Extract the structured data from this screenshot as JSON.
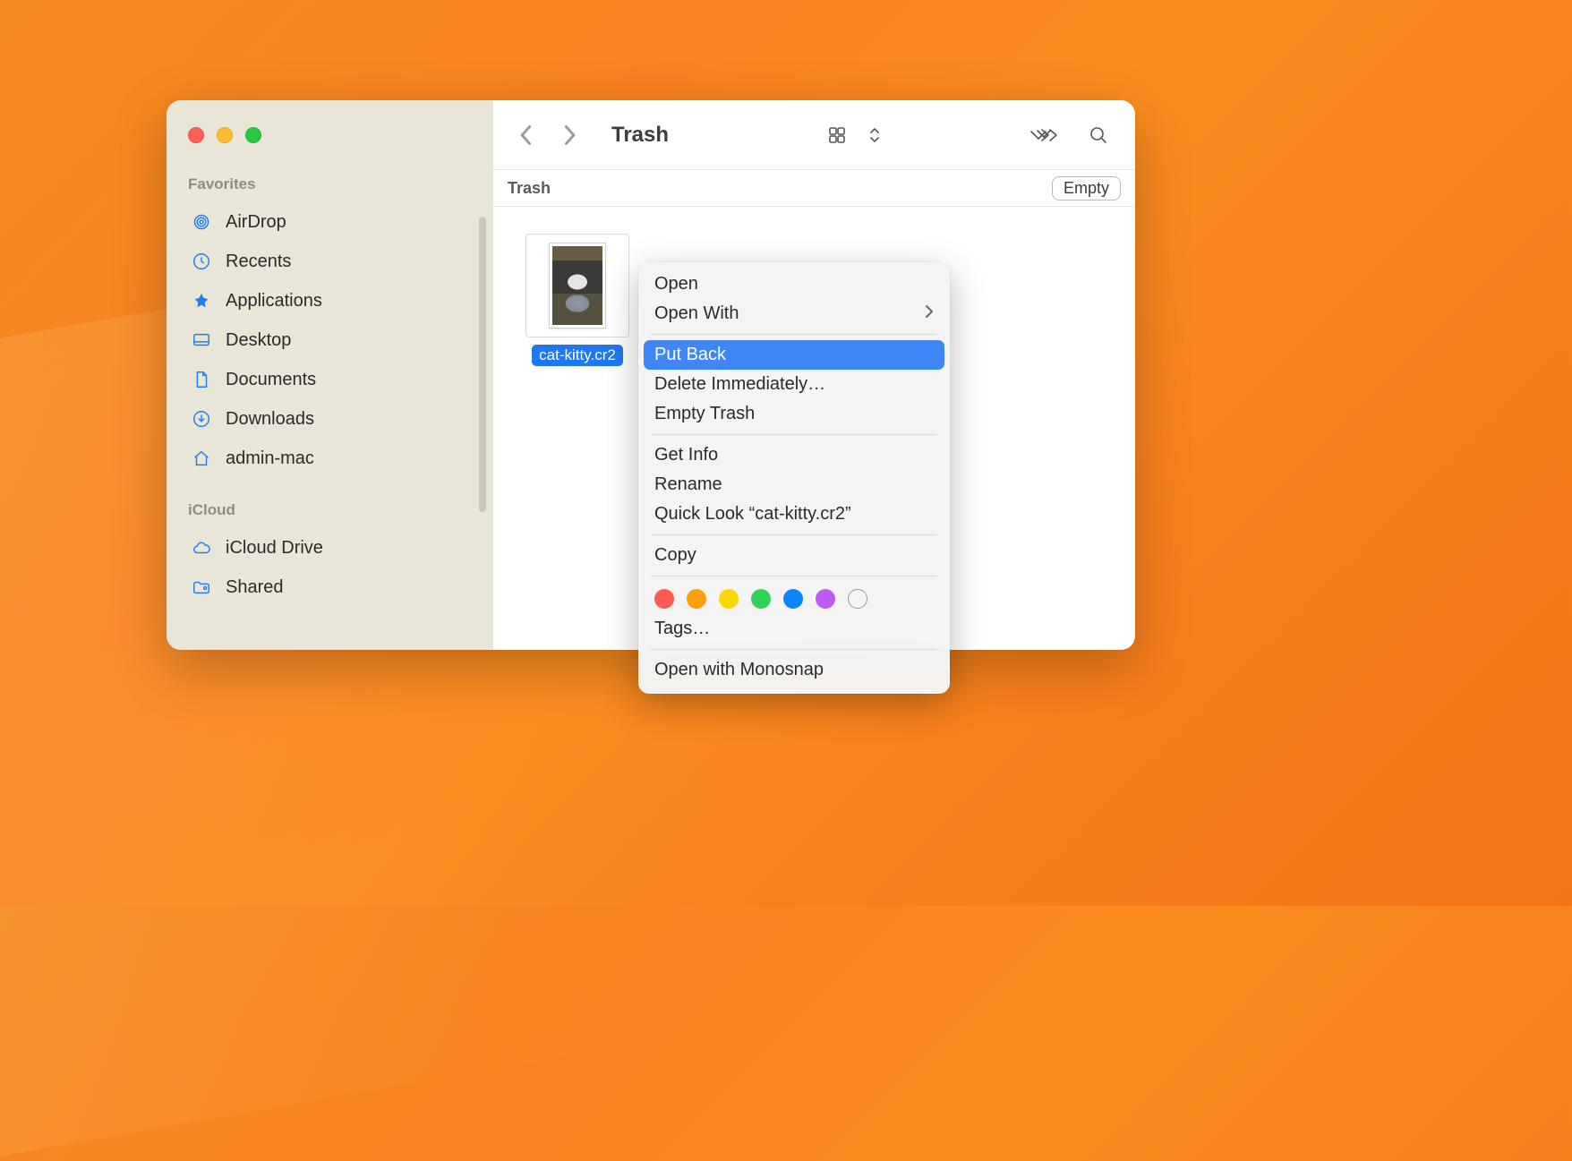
{
  "window": {
    "title": "Trash",
    "location_label": "Trash",
    "empty_button": "Empty"
  },
  "sidebar": {
    "section_favorites": "Favorites",
    "section_icloud": "iCloud",
    "favorites": [
      {
        "label": "AirDrop",
        "icon": "airdrop"
      },
      {
        "label": "Recents",
        "icon": "clock"
      },
      {
        "label": "Applications",
        "icon": "apps"
      },
      {
        "label": "Desktop",
        "icon": "desktop"
      },
      {
        "label": "Documents",
        "icon": "document"
      },
      {
        "label": "Downloads",
        "icon": "download"
      },
      {
        "label": "admin-mac",
        "icon": "home"
      }
    ],
    "icloud": [
      {
        "label": "iCloud Drive",
        "icon": "cloud"
      },
      {
        "label": "Shared",
        "icon": "shared-folder"
      }
    ]
  },
  "file": {
    "name": "cat-kitty.cr2"
  },
  "context_menu": {
    "open": "Open",
    "open_with": "Open With",
    "put_back": "Put Back",
    "delete_immediately": "Delete Immediately…",
    "empty_trash": "Empty Trash",
    "get_info": "Get Info",
    "rename": "Rename",
    "quick_look": "Quick Look “cat-kitty.cr2”",
    "copy": "Copy",
    "tags": "Tags…",
    "open_with_monosnap": "Open with Monosnap"
  },
  "tag_colors": [
    "#ff5b53",
    "#ff9f0a",
    "#ffd60a",
    "#32d158",
    "#0a84ff",
    "#bf5af2"
  ]
}
